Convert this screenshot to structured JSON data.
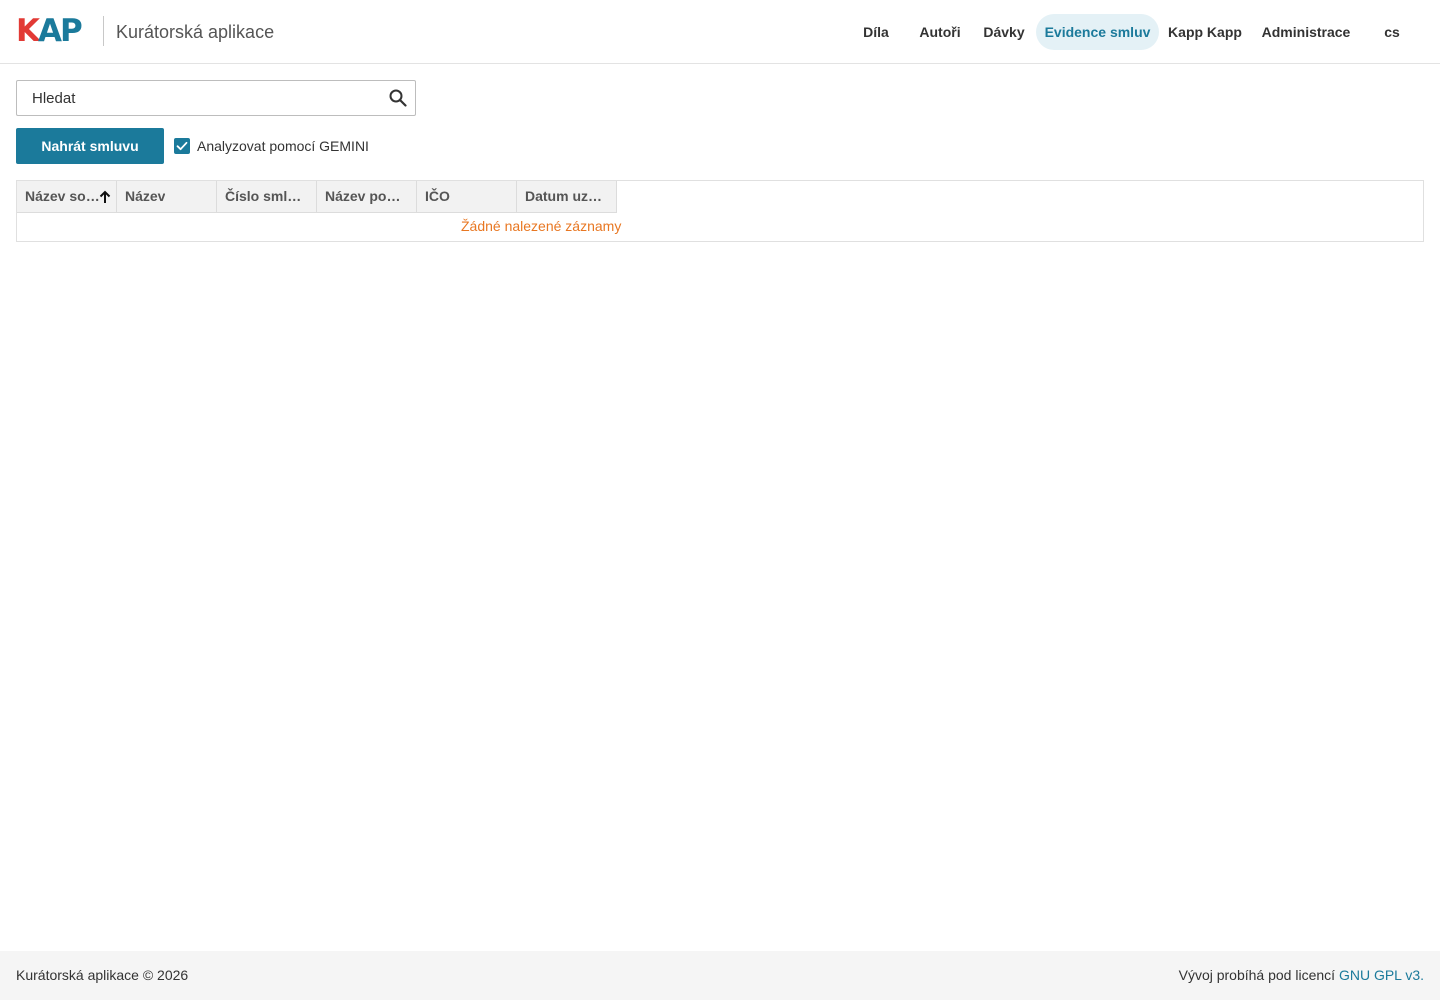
{
  "header": {
    "logo": {
      "k": "K",
      "ap": "AP"
    },
    "app_title": "Kurátorská aplikace",
    "nav": [
      {
        "label": "Díla"
      },
      {
        "label": "Autoři"
      },
      {
        "label": "Dávky"
      },
      {
        "label": "Evidence smluv",
        "active": true
      },
      {
        "label": "Kapp Kapp"
      },
      {
        "label": "Administrace"
      },
      {
        "label": "cs"
      }
    ]
  },
  "toolbar": {
    "search_placeholder": "Hledat",
    "upload_label": "Nahrát smluvu",
    "analyze_label": "Analyzovat pomocí GEMINI",
    "analyze_checked": true
  },
  "grid": {
    "columns": [
      {
        "label": "Název so…",
        "sorted": "asc"
      },
      {
        "label": "Název"
      },
      {
        "label": "Číslo smlo…"
      },
      {
        "label": "Název posk…"
      },
      {
        "label": "IČO"
      },
      {
        "label": "Datum uza…"
      }
    ],
    "empty_message": "Žádné nalezené záznamy"
  },
  "footer": {
    "copyright": "Kurátorská aplikace © 2026",
    "license_prefix": "Vývoj probíhá pod licencí ",
    "license_link": "GNU GPL v3."
  },
  "colors": {
    "accent": "#1b7a9b",
    "logo_red": "#e23a35",
    "warning_text": "#e87722",
    "nav_active_bg": "#e4f1f6"
  }
}
